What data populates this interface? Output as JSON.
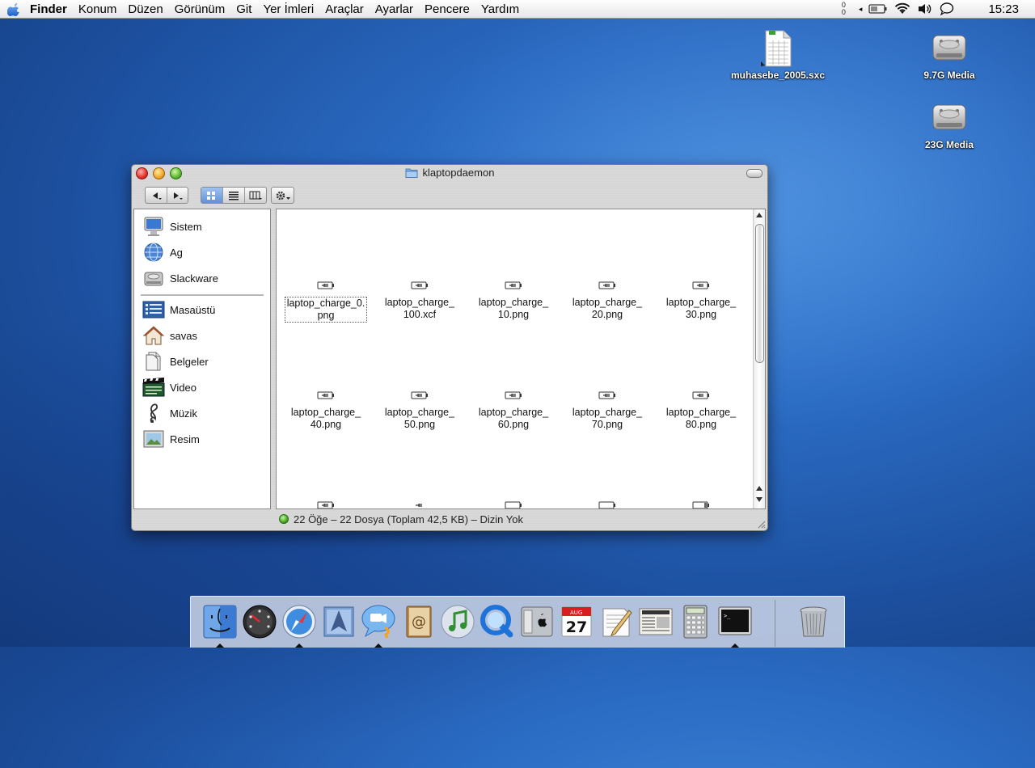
{
  "menubar": {
    "app": "Finder",
    "items": [
      "Konum",
      "Düzen",
      "Görünüm",
      "Git",
      "Yer İmleri",
      "Araçlar",
      "Ayarlar",
      "Pencere",
      "Yardım"
    ],
    "net_top": "0",
    "net_bottom": "0",
    "clock": "15:23"
  },
  "desktop": {
    "icons": [
      {
        "label": "muhasebe_2005.sxc",
        "type": "spreadsheet-file-icon"
      },
      {
        "label": "9.7G Media",
        "type": "hard-drive-icon"
      },
      {
        "label": "23G Media",
        "type": "hard-drive-icon"
      }
    ]
  },
  "window": {
    "title": "klaptopdaemon",
    "sidebar": {
      "devices": [
        {
          "label": "Sistem",
          "icon": "computer-icon"
        },
        {
          "label": "Ag",
          "icon": "network-icon"
        },
        {
          "label": "Slackware",
          "icon": "hard-drive-icon"
        }
      ],
      "places": [
        {
          "label": "Masaüstü",
          "icon": "desktop-icon"
        },
        {
          "label": "savas",
          "icon": "home-icon"
        },
        {
          "label": "Belgeler",
          "icon": "documents-icon"
        },
        {
          "label": "Video",
          "icon": "video-icon"
        },
        {
          "label": "Müzik",
          "icon": "music-icon"
        },
        {
          "label": "Resim",
          "icon": "pictures-icon"
        }
      ]
    },
    "files": [
      {
        "line1": "laptop_charge_0.",
        "line2": "png",
        "selected": true
      },
      {
        "line1": "laptop_charge_",
        "line2": "100.xcf",
        "selected": false
      },
      {
        "line1": "laptop_charge_",
        "line2": "10.png",
        "selected": false
      },
      {
        "line1": "laptop_charge_",
        "line2": "20.png",
        "selected": false
      },
      {
        "line1": "laptop_charge_",
        "line2": "30.png",
        "selected": false
      },
      {
        "line1": "laptop_charge_",
        "line2": "40.png",
        "selected": false
      },
      {
        "line1": "laptop_charge_",
        "line2": "50.png",
        "selected": false
      },
      {
        "line1": "laptop_charge_",
        "line2": "60.png",
        "selected": false
      },
      {
        "line1": "laptop_charge_",
        "line2": "70.png",
        "selected": false
      },
      {
        "line1": "laptop_charge_",
        "line2": "80.png",
        "selected": false
      }
    ],
    "status": "22 Öğe – 22 Dosya (Toplam 42,5 KB) – Dizin Yok"
  },
  "dock": {
    "apps": [
      "finder",
      "dashboard",
      "safari",
      "mail",
      "ichat",
      "address-book",
      "itunes",
      "quicktime",
      "system-preferences",
      "ical",
      "textedit",
      "news",
      "calculator",
      "terminal"
    ],
    "ical_month": "AUG",
    "ical_day": "27"
  },
  "colors": {
    "desktop": "#2b6cc4",
    "selection": "#5f92d8"
  }
}
